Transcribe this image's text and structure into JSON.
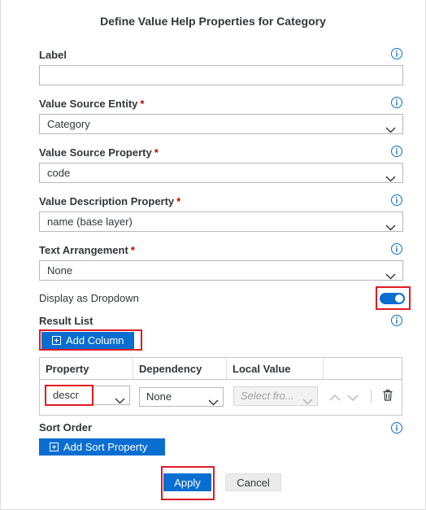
{
  "dialog": {
    "title": "Define Value Help Properties for Category"
  },
  "fields": {
    "label": {
      "label": "Label",
      "value": ""
    },
    "value_source_entity": {
      "label": "Value Source Entity",
      "required": "*",
      "value": "Category"
    },
    "value_source_property": {
      "label": "Value Source Property",
      "required": "*",
      "value": "code"
    },
    "value_description_property": {
      "label": "Value Description Property",
      "required": "*",
      "value": "name (base layer)"
    },
    "text_arrangement": {
      "label": "Text Arrangement",
      "required": "*",
      "value": "None"
    }
  },
  "display_as_dropdown": {
    "label": "Display as Dropdown",
    "enabled": true
  },
  "result_list": {
    "label": "Result List",
    "add_column_label": "Add Column",
    "columns": [
      "Property",
      "Dependency",
      "Local Value"
    ],
    "rows": [
      {
        "property": "descr",
        "dependency": "None",
        "local_value_placeholder": "Select fro..."
      }
    ]
  },
  "sort_order": {
    "label": "Sort Order",
    "add_sort_label": "Add Sort Property"
  },
  "footer": {
    "apply_label": "Apply",
    "cancel_label": "Cancel"
  },
  "colors": {
    "accent": "#0a6ed1",
    "highlight": "#e01b24",
    "required": "#bb0000"
  },
  "icons": [
    "info-icon",
    "chevron-down-icon",
    "plus-icon",
    "arrow-up-icon",
    "arrow-down-icon",
    "trash-icon"
  ]
}
